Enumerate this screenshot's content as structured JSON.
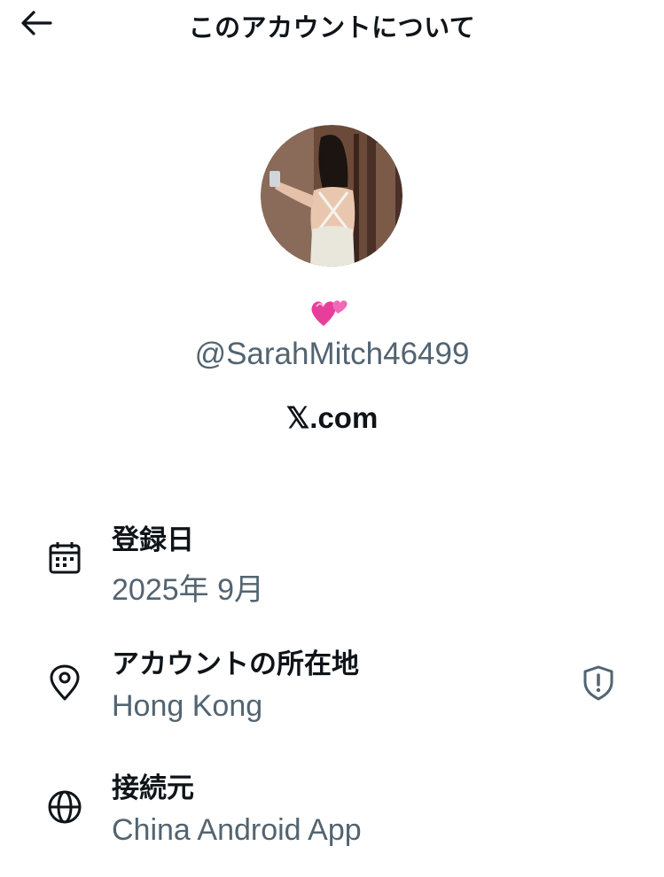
{
  "header": {
    "back_icon": "arrow-left-icon",
    "title": "このアカウントについて"
  },
  "profile": {
    "avatar_icon": "profile-photo",
    "emoji_icon": "revolving-hearts-icon",
    "handle": "@SarahMitch46499",
    "site": "𝕏.com"
  },
  "details": [
    {
      "icon": "calendar-icon",
      "label": "登録日",
      "value": "2025年 9月"
    },
    {
      "icon": "location-pin-icon",
      "label": "アカウントの所在地",
      "value": "Hong Kong",
      "extra_icon": "shield-alert-icon"
    },
    {
      "icon": "globe-icon",
      "label": "接続元",
      "value": "China Android App"
    }
  ],
  "colors": {
    "primary_text": "#0f1419",
    "secondary_text": "#536471",
    "background": "#ffffff"
  }
}
